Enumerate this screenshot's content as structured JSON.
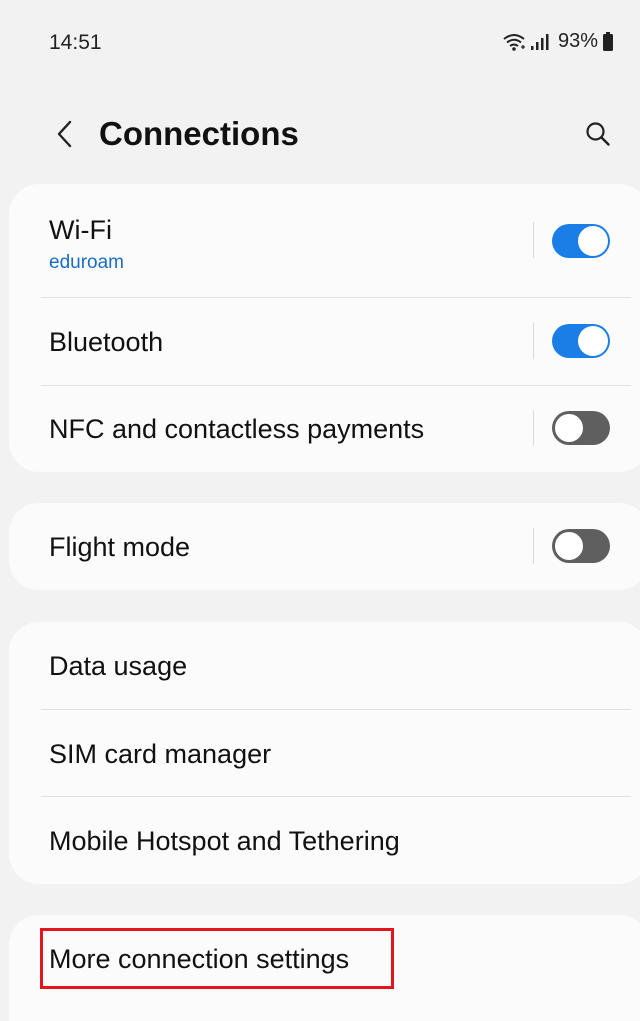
{
  "status_bar": {
    "time": "14:51",
    "battery": "93%"
  },
  "header": {
    "title": "Connections"
  },
  "groups": [
    {
      "items": [
        {
          "label": "Wi-Fi",
          "sublabel": "eduroam",
          "toggle": "on"
        },
        {
          "label": "Bluetooth",
          "toggle": "on"
        },
        {
          "label": "NFC and contactless payments",
          "toggle": "off"
        }
      ]
    },
    {
      "items": [
        {
          "label": "Flight mode",
          "toggle": "off"
        }
      ]
    },
    {
      "items": [
        {
          "label": "Data usage"
        },
        {
          "label": "SIM card manager"
        },
        {
          "label": "Mobile Hotspot and Tethering"
        }
      ]
    },
    {
      "items": [
        {
          "label": "More connection settings",
          "highlighted": true
        }
      ]
    }
  ],
  "colors": {
    "accent": "#1b7ee6",
    "sublabel": "#1a6cc9",
    "highlight": "#e3161f",
    "toggle_off": "#5f5f5f",
    "background": "#f2f2f2",
    "card": "#fbfbfb"
  }
}
